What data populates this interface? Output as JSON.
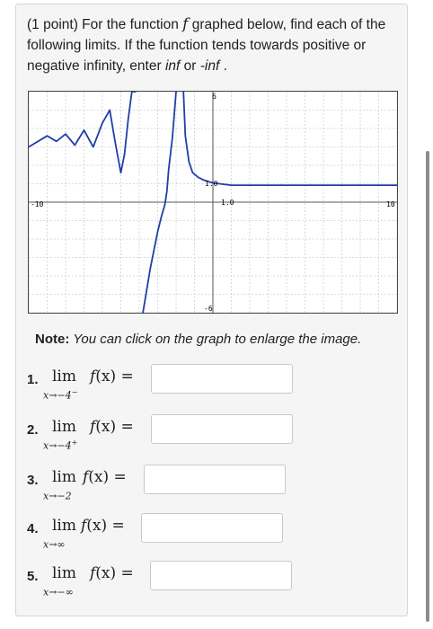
{
  "prompt": {
    "part1": "(1 point) For the function ",
    "func": "f",
    "part2": " graphed below, find each of the following limits. If the function tends towards positive or negative infinity, enter ",
    "inf": "inf",
    "part3": " or ",
    "neg_inf": "-inf",
    "part4": " ."
  },
  "graph": {
    "x_min_label": "-10",
    "x_max_label": "10",
    "y_max_label": "6",
    "y_min_label": "-6",
    "y_tick_label": "1.0",
    "x_tick_label": "1.0",
    "curve_color": "#1f3fa8",
    "chart_data": {
      "type": "line",
      "xlim": [
        -10,
        10
      ],
      "ylim": [
        -6,
        6
      ],
      "grid": true,
      "vertical_asymptote_x": -4,
      "horizontal_asymptote_right_y": 1,
      "series": [
        {
          "x": [
            -10,
            -9.5,
            -9,
            -8.5,
            -8,
            -7.5,
            -7,
            -6.5,
            -6,
            -5.6,
            -5.3,
            -5,
            -4.8,
            -4.6,
            -4.4,
            -4.3,
            -4.2
          ],
          "y": [
            3,
            3.3,
            3.6,
            3.3,
            3.7,
            3.1,
            3.9,
            3.0,
            4.3,
            5.0,
            3.2,
            1.6,
            2.6,
            4.5,
            6.0,
            6.0,
            6.0
          ]
        },
        {
          "x": [
            -3.8,
            -3.6,
            -3.4,
            -3.2,
            -3,
            -2.8,
            -2.6,
            -2.5,
            -2.4,
            -2.2,
            -2
          ],
          "y": [
            -6,
            -4.8,
            -3.6,
            -2.6,
            -1.6,
            -0.8,
            -0.1,
            0.6,
            1.8,
            3.5,
            6
          ]
        },
        {
          "x": [
            -1.6,
            -1.5,
            -1.3,
            -1.1,
            -0.8,
            -0.5,
            -0.2,
            0,
            0.5,
            1,
            2,
            4,
            6,
            8,
            10
          ],
          "y": [
            6,
            3.6,
            2.2,
            1.6,
            1.35,
            1.2,
            1.1,
            1.05,
            0.98,
            0.92,
            0.92,
            0.92,
            0.92,
            0.92,
            0.92
          ]
        }
      ]
    }
  },
  "note": {
    "bold": "Note:",
    "text": " You can click on the graph to enlarge the image."
  },
  "limits": [
    {
      "num": "1.",
      "lim": "lim",
      "sub": "x→−4",
      "sup": "−",
      "expr_f": "f",
      "expr_rest": "(x) =",
      "value": ""
    },
    {
      "num": "2.",
      "lim": "lim",
      "sub": "x→−4",
      "sup": "+",
      "expr_f": "f",
      "expr_rest": "(x) =",
      "value": ""
    },
    {
      "num": "3.",
      "lim": "lim",
      "sub": "x→−2",
      "sup": "",
      "expr_f": "f",
      "expr_rest": "(x) =",
      "value": ""
    },
    {
      "num": "4.",
      "lim": "lim",
      "sub": "x→∞",
      "sup": "",
      "expr_f": "f",
      "expr_rest": "(x) =",
      "value": ""
    },
    {
      "num": "5.",
      "lim": "lim",
      "sub": "x→−∞",
      "sup": "",
      "expr_f": "f",
      "expr_rest": "(x) =",
      "value": ""
    }
  ]
}
